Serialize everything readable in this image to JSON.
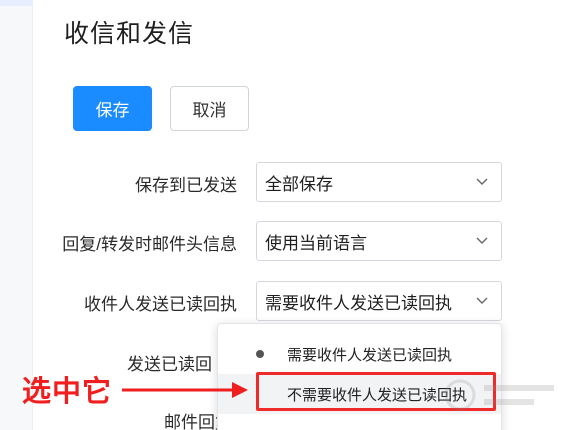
{
  "page": {
    "title": "收信和发信"
  },
  "toolbar": {
    "save_label": "保存",
    "cancel_label": "取消"
  },
  "settings": [
    {
      "label": "保存到已发送",
      "value": "全部保存"
    },
    {
      "label": "回复/转发时邮件头信息",
      "value": "使用当前语言"
    },
    {
      "label": "收件人发送已读回执",
      "value": "需要收件人发送已读回执"
    }
  ],
  "hidden_rows": [
    {
      "label": "发送已读回"
    },
    {
      "label": "邮件回复"
    }
  ],
  "dropdown": {
    "options": [
      {
        "label": "需要收件人发送已读回执",
        "selected": true
      },
      {
        "label": "不需要收件人发送已读回执",
        "selected": false
      }
    ]
  },
  "annotation": {
    "text": "选中它",
    "color": "#f01e1e"
  },
  "colors": {
    "primary": "#1a8cff",
    "highlight": "#ef2a2a"
  },
  "icons": {
    "chevron": "chevron-down-icon",
    "selected_dot": "dot-icon"
  }
}
